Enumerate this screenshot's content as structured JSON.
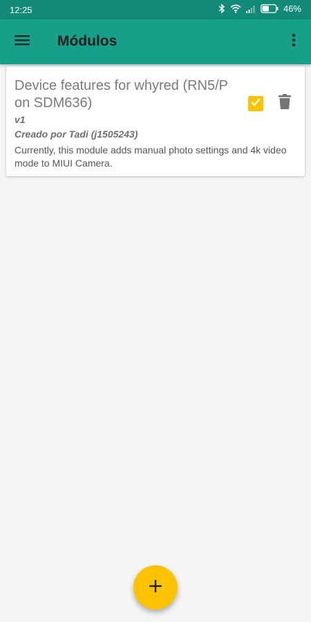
{
  "status_bar": {
    "time": "12:25",
    "battery_percent": "46%",
    "icons": [
      "bluetooth-icon",
      "wifi-icon",
      "signal-icon",
      "battery-icon"
    ],
    "background": "#128a78"
  },
  "app_bar": {
    "title": "Módulos",
    "menu_icon": "hamburger-menu-icon",
    "overflow_icon": "more-vert-icon",
    "background": "#16a08a"
  },
  "modules": [
    {
      "title": "Device features for whyred (RN5/P on SDM636)",
      "version": "v1",
      "author": "Creado por Tadi (j1505243)",
      "description": "Currently, this module adds manual photo settings and 4k video mode to MIUI Camera.",
      "enabled": true,
      "checkbox_color": "#fdc200",
      "delete_icon": "trash-icon"
    }
  ],
  "fab": {
    "icon": "plus-icon",
    "color": "#fdc300"
  }
}
